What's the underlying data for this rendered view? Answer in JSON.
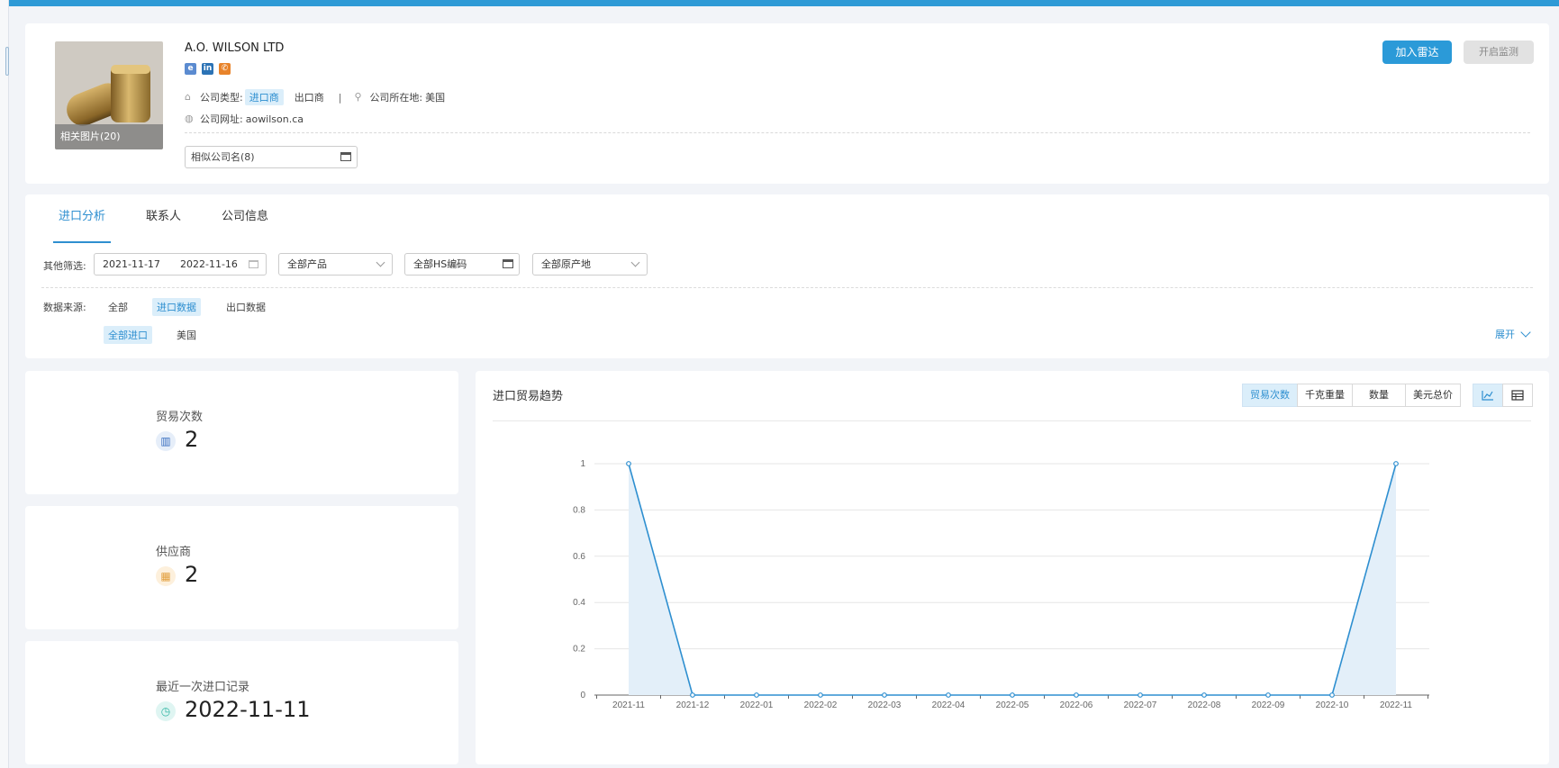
{
  "company": {
    "name": "A.O. WILSON LTD",
    "photo_label": "相关图片(20)",
    "social_icons": [
      "ie-icon",
      "linkedin-icon",
      "phone-icon"
    ],
    "type_label": "公司类型:",
    "type_importer": "进口商",
    "type_exporter": "出口商",
    "separator": "|",
    "location_label": "公司所在地:",
    "location_value": "美国",
    "website_label": "公司网址:",
    "website_value": "aowilson.ca",
    "similar_names": "相似公司名(8)"
  },
  "actions": {
    "add_radar": "加入雷达",
    "start_monitor": "开启监测"
  },
  "tabs": [
    {
      "label": "进口分析"
    },
    {
      "label": "联系人"
    },
    {
      "label": "公司信息"
    }
  ],
  "filters": {
    "label": "其他筛选:",
    "date_start": "2021-11-17",
    "date_end": "2022-11-16",
    "product": "全部产品",
    "hs_code": "全部HS编码",
    "origin": "全部原产地",
    "source_label": "数据来源:",
    "source_all": "全部",
    "source_import": "进口数据",
    "source_export": "出口数据",
    "scope_all_import": "全部进口",
    "scope_country": "美国",
    "expand": "展开"
  },
  "stats": {
    "trades_label": "贸易次数",
    "trades_value": "2",
    "suppliers_label": "供应商",
    "suppliers_value": "2",
    "last_import_label": "最近一次进口记录",
    "last_import_value": "2022-11-11"
  },
  "chart_panel": {
    "title": "进口贸易趋势",
    "metric_buttons": [
      "贸易次数",
      "千克重量",
      "数量",
      "美元总价"
    ],
    "view_icons": [
      "line-chart-icon",
      "table-icon"
    ]
  },
  "colors": {
    "accent": "#2e8fd0",
    "topbar": "#2e9ad6",
    "button_primary": "#2b9ad8",
    "chart_line": "#2e8fd0",
    "chart_fill": "#e3eff9"
  },
  "chart_data": {
    "type": "area",
    "title": "",
    "xlabel": "",
    "ylabel": "",
    "x": [
      "2021-11",
      "2021-12",
      "2022-01",
      "2022-02",
      "2022-03",
      "2022-04",
      "2022-05",
      "2022-06",
      "2022-07",
      "2022-08",
      "2022-09",
      "2022-10",
      "2022-11"
    ],
    "series": [
      {
        "values": [
          1,
          0,
          0,
          0,
          0,
          0,
          0,
          0,
          0,
          0,
          0,
          0,
          1
        ]
      }
    ],
    "ylim": [
      0,
      1
    ],
    "yticks": [
      0,
      0.2,
      0.4,
      0.6,
      0.8,
      1
    ],
    "ytick_labels": [
      "0",
      "0.2",
      "0.4",
      "0.6",
      "0.8",
      "1"
    ],
    "grid": true,
    "legend": "none"
  }
}
